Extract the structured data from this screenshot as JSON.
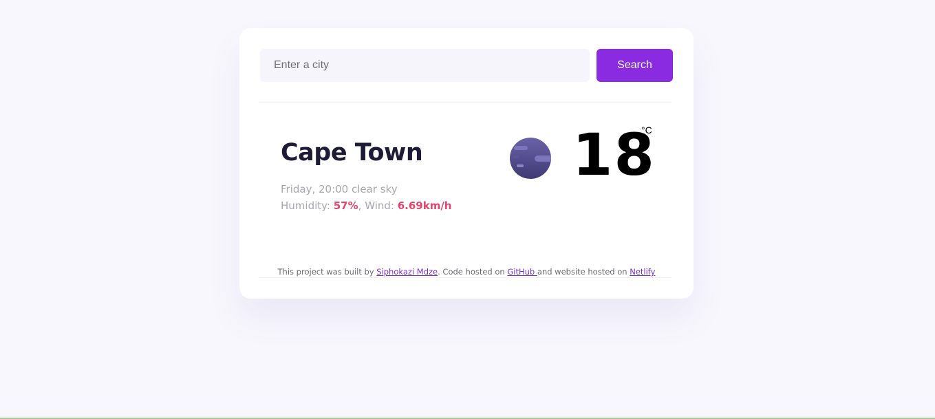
{
  "search": {
    "placeholder": "Enter a city",
    "value": "",
    "button_label": "Search"
  },
  "weather": {
    "city": "Cape Town",
    "datetime": "Friday, 20:00",
    "description": "clear sky",
    "humidity_label": "Humidity: ",
    "humidity_value": "57%",
    "wind_label": ", Wind: ",
    "wind_value": "6.69km/h",
    "temperature": "18",
    "unit": "°C",
    "icon": "night-clear-icon"
  },
  "footer": {
    "text_1": "This project was built by ",
    "author_link": "Siphokazi Mdze",
    "text_2": ". Code hosted on ",
    "github_link": "GitHub ",
    "text_3": "and website hosted on ",
    "netlify_link": "Netlify"
  },
  "colors": {
    "background": "#f8f7fd",
    "accent": "#8a2be2",
    "highlight": "#e4466f",
    "heading": "#1e1b36",
    "muted": "#a7a6b2"
  }
}
